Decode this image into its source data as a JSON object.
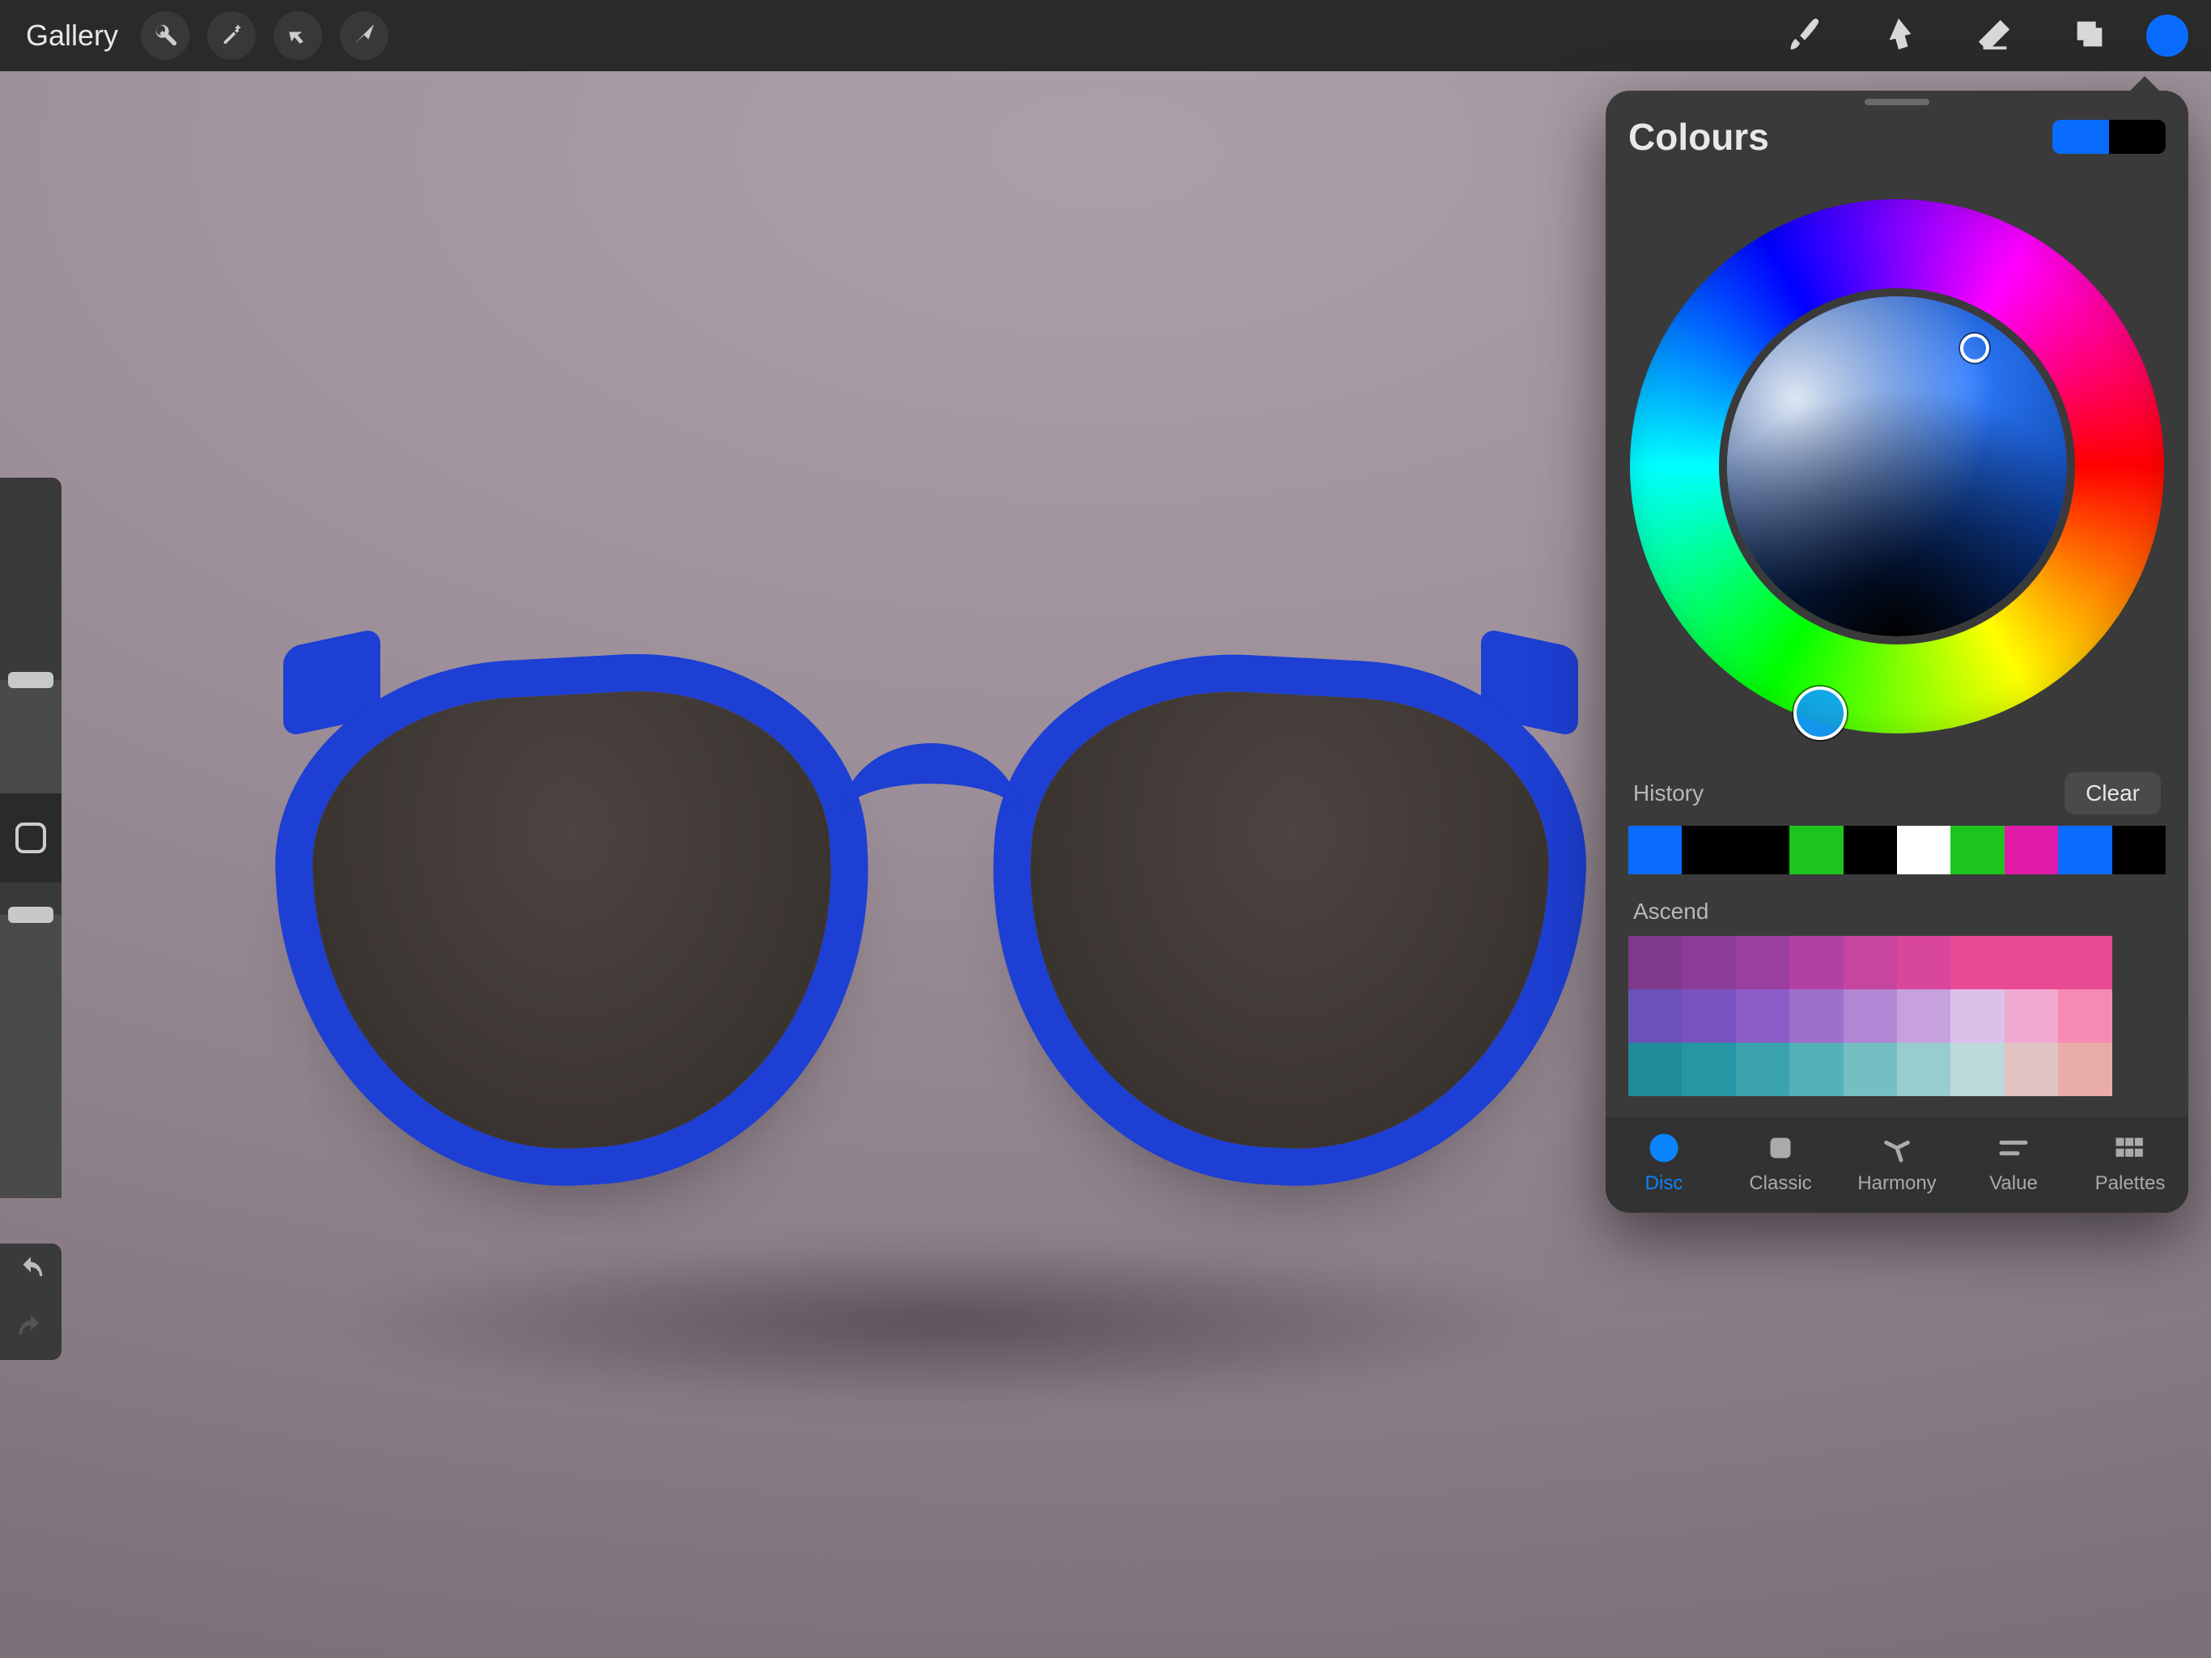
{
  "topbar": {
    "gallery": "Gallery"
  },
  "panel": {
    "title": "Colours",
    "primary": "#0a6cff",
    "secondary": "#000000",
    "history_label": "History",
    "clear_label": "Clear",
    "history": [
      "#0a6cff",
      "#000000",
      "#000000",
      "#1ec41e",
      "#000000",
      "#ffffff",
      "#1ec41e",
      "#e01ba8",
      "#0a6cff",
      "#000000"
    ],
    "palette_name": "Ascend",
    "palette": [
      [
        "#7f3a8e",
        "#8d3c98",
        "#9a3fa0",
        "#b142a3",
        "#c7449f",
        "#d9479b",
        "#e84a94",
        "#e84a94",
        "#e84a94",
        "#3a3a3a"
      ],
      [
        "#6a52b9",
        "#7a52c0",
        "#8c5cc6",
        "#9f6fcc",
        "#b286d4",
        "#c7a1de",
        "#dcc0ea",
        "#f0a9cf",
        "#f58bb4",
        "#3a3a3a"
      ],
      [
        "#1e8a9a",
        "#2596a4",
        "#3aa3ae",
        "#55b1b8",
        "#75bfc3",
        "#98cdd0",
        "#bcd9dc",
        "#e1c3c4",
        "#e9aca9",
        "#3a3a3a"
      ]
    ],
    "tabs": {
      "disc": "Disc",
      "classic": "Classic",
      "harmony": "Harmony",
      "value": "Value",
      "palettes": "Palettes"
    }
  }
}
